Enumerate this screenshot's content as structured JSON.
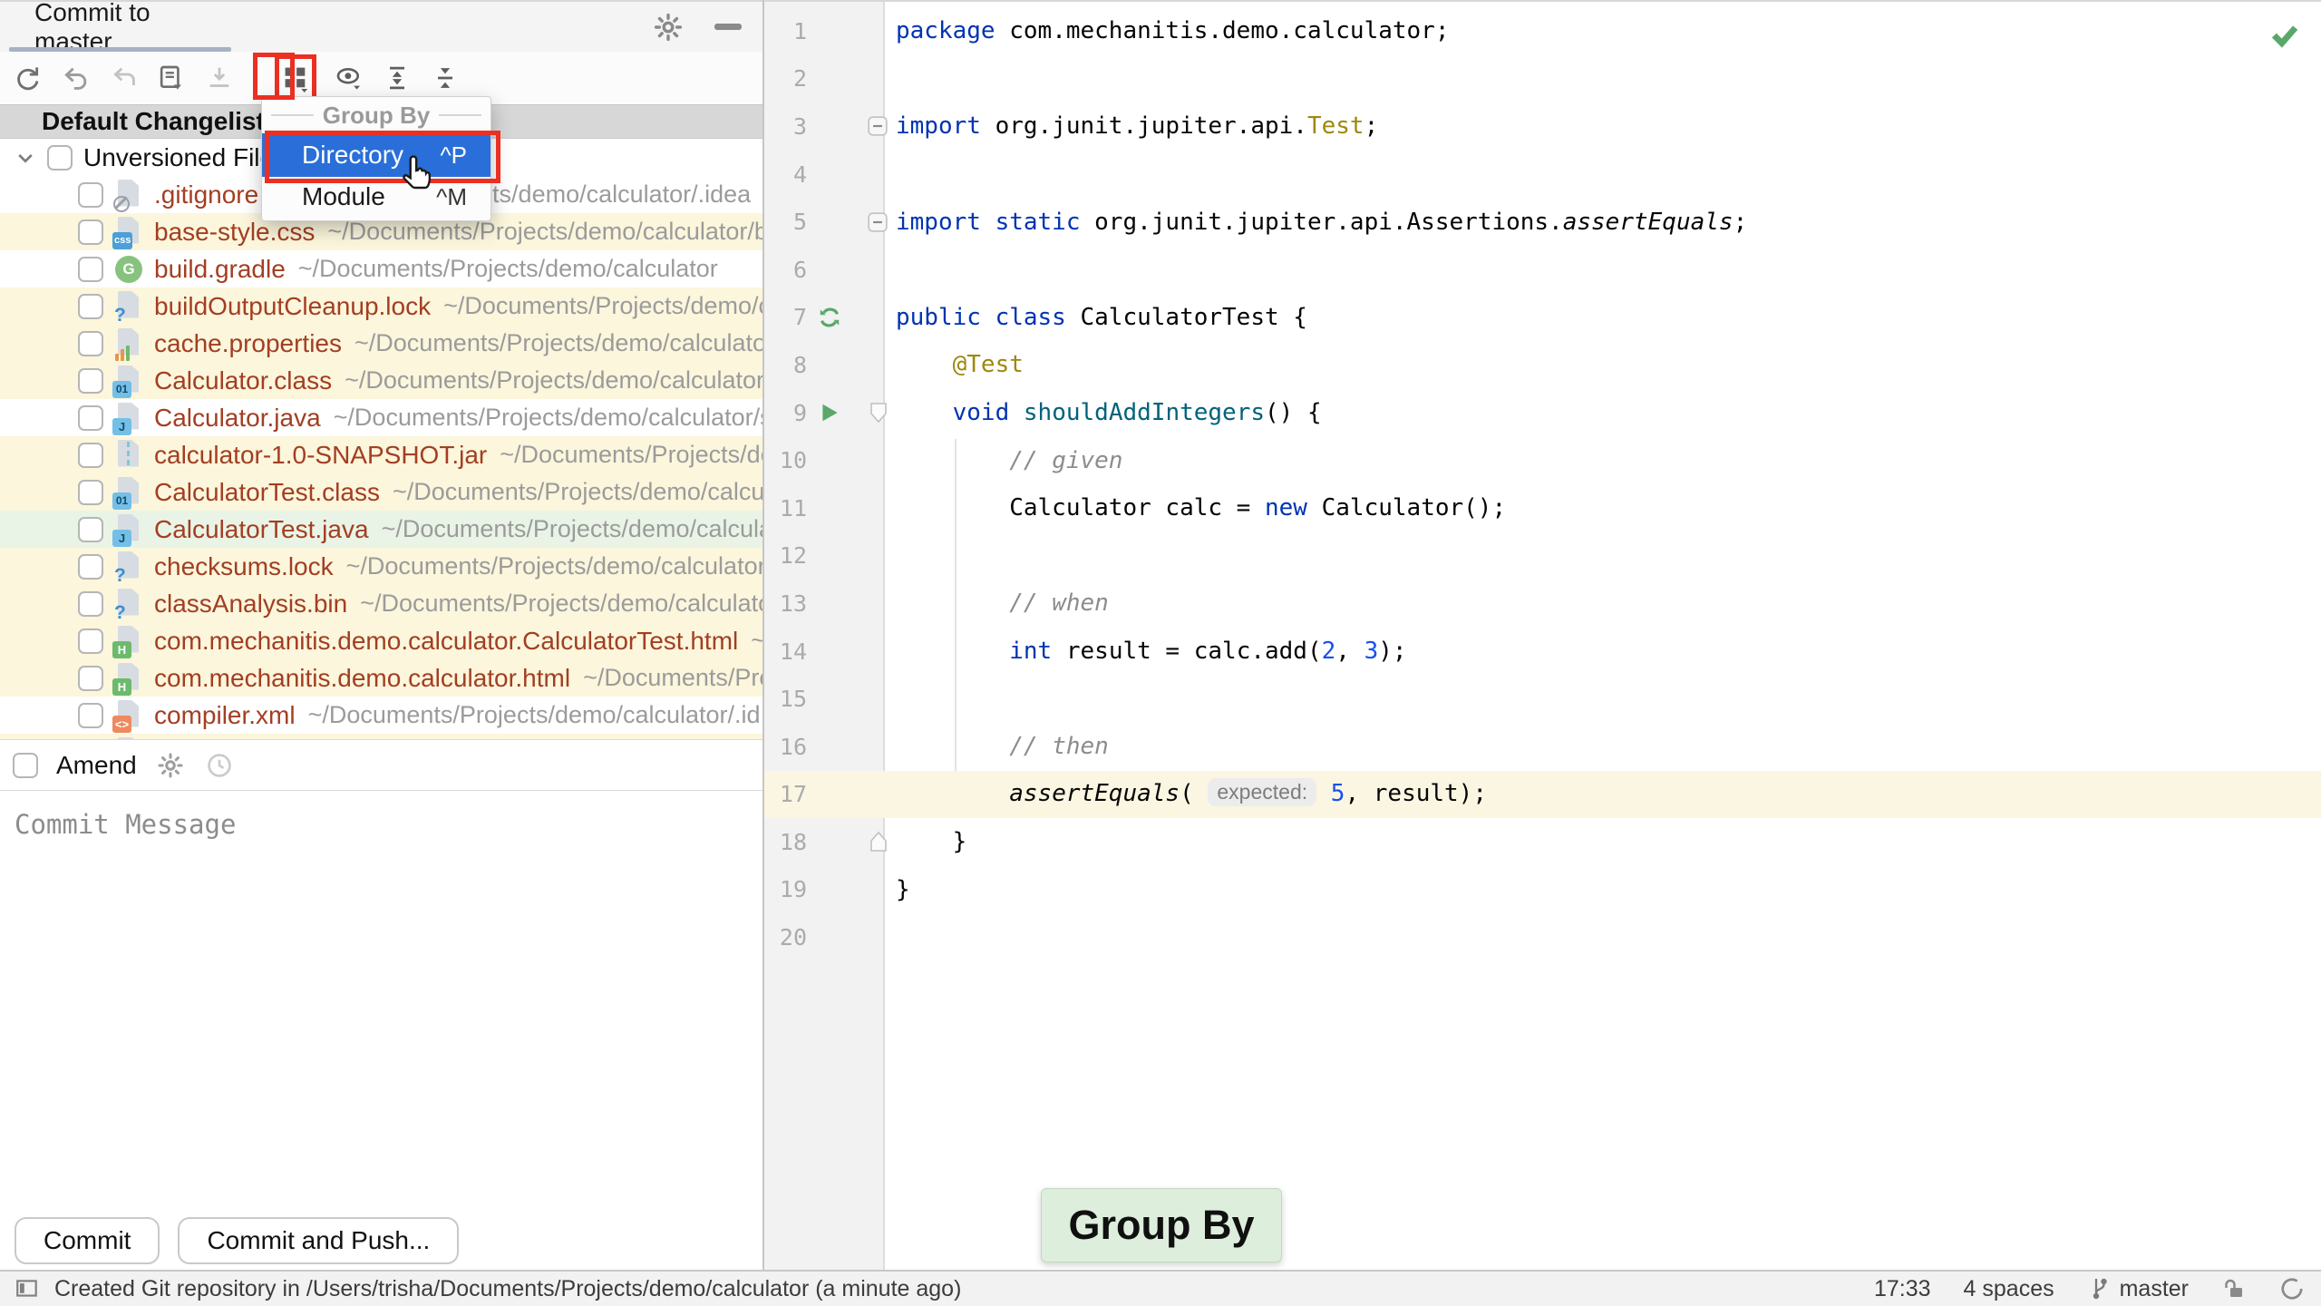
{
  "window": {
    "tab_title": "Commit to master"
  },
  "colors": {
    "annotation_red": "#EB2F23",
    "menu_selection_blue": "#2A6FD9",
    "overlay_green_bg": "#DDEEDC",
    "unversioned_file_red": "#A33E22",
    "yellow_row_bg": "#FBF6DC",
    "green_row_bg": "#E9F4E6"
  },
  "toolbar": {
    "icons": [
      "refresh-icon",
      "undo-icon",
      "rollback-icon",
      "changelist-icon",
      "shelve-icon",
      "group-by-icon",
      "preview-icon",
      "expand-all-icon",
      "collapse-all-icon"
    ]
  },
  "changelist": {
    "header": "Default Changelist",
    "root_label": "Unversioned Files",
    "root_checked": false,
    "files": [
      {
        "name": ".gitignore",
        "path": "~/Documents/Projects/demo/calculator/.idea",
        "icon": "ignored-file-icon",
        "bg": "white",
        "checked": false
      },
      {
        "name": "base-style.css",
        "path": "~/Documents/Projects/demo/calculator/b",
        "icon": "css-file-icon",
        "bg": "yellow",
        "checked": false
      },
      {
        "name": "build.gradle",
        "path": "~/Documents/Projects/demo/calculator",
        "icon": "gradle-file-icon",
        "bg": "white",
        "checked": false
      },
      {
        "name": "buildOutputCleanup.lock",
        "path": "~/Documents/Projects/demo/c",
        "icon": "unknown-file-icon",
        "bg": "yellow",
        "checked": false
      },
      {
        "name": "cache.properties",
        "path": "~/Documents/Projects/demo/calculato",
        "icon": "properties-file-icon",
        "bg": "yellow",
        "checked": false
      },
      {
        "name": "Calculator.class",
        "path": "~/Documents/Projects/demo/calculator/",
        "icon": "class-file-icon",
        "bg": "yellow",
        "checked": false
      },
      {
        "name": "Calculator.java",
        "path": "~/Documents/Projects/demo/calculator/s",
        "icon": "java-file-icon",
        "bg": "white",
        "checked": false
      },
      {
        "name": "calculator-1.0-SNAPSHOT.jar",
        "path": "~/Documents/Projects/de",
        "icon": "jar-file-icon",
        "bg": "yellow",
        "checked": false
      },
      {
        "name": "CalculatorTest.class",
        "path": "~/Documents/Projects/demo/calcul",
        "icon": "class-file-icon",
        "bg": "yellow",
        "checked": false
      },
      {
        "name": "CalculatorTest.java",
        "path": "~/Documents/Projects/demo/calcula",
        "icon": "java-file-icon",
        "bg": "green",
        "checked": false
      },
      {
        "name": "checksums.lock",
        "path": "~/Documents/Projects/demo/calculator",
        "icon": "unknown-file-icon",
        "bg": "yellow",
        "checked": false
      },
      {
        "name": "classAnalysis.bin",
        "path": "~/Documents/Projects/demo/calculato",
        "icon": "unknown-file-icon",
        "bg": "yellow",
        "checked": false
      },
      {
        "name": "com.mechanitis.demo.calculator.CalculatorTest.html",
        "path": "~/D",
        "icon": "html-file-icon",
        "bg": "yellow",
        "checked": false
      },
      {
        "name": "com.mechanitis.demo.calculator.html",
        "path": "~/Documents/Pro",
        "icon": "html-file-icon",
        "bg": "yellow",
        "checked": false
      },
      {
        "name": "compiler.xml",
        "path": "~/Documents/Projects/demo/calculator/.id",
        "icon": "xml-file-icon",
        "bg": "white",
        "checked": false
      },
      {
        "name": "",
        "path": "",
        "icon": "unknown-file-icon",
        "bg": "yellow",
        "checked": false
      }
    ]
  },
  "menu": {
    "title": "Group By",
    "items": [
      {
        "label": "Directory",
        "shortcut": "^P",
        "selected": true
      },
      {
        "label": "Module",
        "shortcut": "^M",
        "selected": false
      }
    ]
  },
  "amend": {
    "label": "Amend",
    "checked": false
  },
  "commit_message": {
    "placeholder": "Commit Message",
    "value": ""
  },
  "actions": {
    "commit": "Commit",
    "commit_and_push": "Commit and Push..."
  },
  "editor": {
    "overlay_label": "Group By",
    "inspection_status": "no-problems",
    "lines": [
      {
        "n": 1,
        "seg": [
          [
            "kw",
            "package"
          ],
          [
            "t",
            " com.mechanitis.demo.calculator;"
          ]
        ]
      },
      {
        "n": 2,
        "seg": []
      },
      {
        "n": 3,
        "fold": "minus",
        "seg": [
          [
            "kw",
            "import"
          ],
          [
            "t",
            " org.junit.jupiter.api."
          ],
          [
            "ann",
            "Test"
          ],
          [
            "t",
            ";"
          ]
        ]
      },
      {
        "n": 4,
        "seg": []
      },
      {
        "n": 5,
        "fold": "minus",
        "seg": [
          [
            "kw",
            "import static"
          ],
          [
            "t",
            " org.junit.jupiter.api.Assertions."
          ],
          [
            "it",
            "assertEquals"
          ],
          [
            "t",
            ";"
          ]
        ]
      },
      {
        "n": 6,
        "seg": []
      },
      {
        "n": 7,
        "run": "rerun",
        "seg": [
          [
            "kw",
            "public class"
          ],
          [
            "t",
            " CalculatorTest {"
          ]
        ]
      },
      {
        "n": 8,
        "seg": [
          [
            "t",
            "    "
          ],
          [
            "ann",
            "@Test"
          ]
        ]
      },
      {
        "n": 9,
        "run": "play",
        "fold": "down",
        "seg": [
          [
            "t",
            "    "
          ],
          [
            "kw",
            "void"
          ],
          [
            "t",
            " "
          ],
          [
            "mth",
            "shouldAddIntegers"
          ],
          [
            "t",
            "() {"
          ]
        ]
      },
      {
        "n": 10,
        "seg": [
          [
            "t",
            "        "
          ],
          [
            "cmt",
            "// given"
          ]
        ]
      },
      {
        "n": 11,
        "seg": [
          [
            "t",
            "        Calculator calc = "
          ],
          [
            "kw",
            "new"
          ],
          [
            "t",
            " Calculator();"
          ]
        ]
      },
      {
        "n": 12,
        "seg": []
      },
      {
        "n": 13,
        "seg": [
          [
            "t",
            "        "
          ],
          [
            "cmt",
            "// when"
          ]
        ]
      },
      {
        "n": 14,
        "seg": [
          [
            "t",
            "        "
          ],
          [
            "kw",
            "int"
          ],
          [
            "t",
            " result = calc.add("
          ],
          [
            "num",
            "2"
          ],
          [
            "t",
            ", "
          ],
          [
            "num",
            "3"
          ],
          [
            "t",
            ");"
          ]
        ]
      },
      {
        "n": 15,
        "seg": []
      },
      {
        "n": 16,
        "seg": [
          [
            "t",
            "        "
          ],
          [
            "cmt",
            "// then"
          ]
        ]
      },
      {
        "n": 17,
        "hl": true,
        "seg": [
          [
            "t",
            "        "
          ],
          [
            "it",
            "assertEquals"
          ],
          [
            "t",
            "( "
          ],
          [
            "hint",
            "expected:"
          ],
          [
            "t",
            " "
          ],
          [
            "num",
            "5"
          ],
          [
            "t",
            ", result);"
          ]
        ]
      },
      {
        "n": 18,
        "fold": "up",
        "seg": [
          [
            "t",
            "    }"
          ]
        ]
      },
      {
        "n": 19,
        "seg": [
          [
            "t",
            "}"
          ]
        ]
      },
      {
        "n": 20,
        "seg": []
      }
    ]
  },
  "status": {
    "message": "Created Git repository in /Users/trisha/Documents/Projects/demo/calculator (a minute ago)",
    "time": "17:33",
    "indent_info": "4 spaces",
    "branch": "master"
  }
}
